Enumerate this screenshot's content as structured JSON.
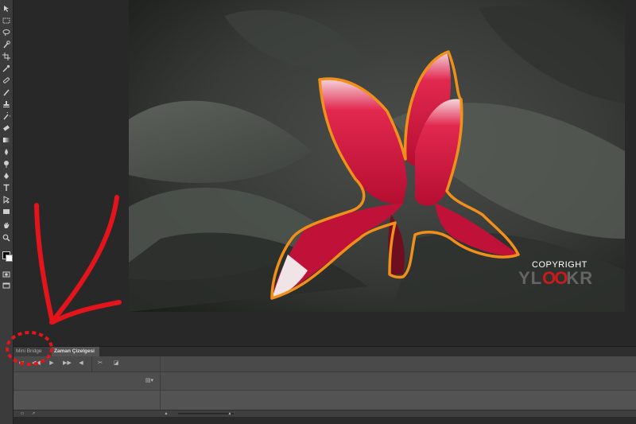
{
  "tools": [
    {
      "name": "move-tool-icon"
    },
    {
      "name": "marquee-tool-icon"
    },
    {
      "name": "lasso-tool-icon"
    },
    {
      "name": "quick-selection-tool-icon"
    },
    {
      "name": "crop-tool-icon"
    },
    {
      "name": "eyedropper-tool-icon"
    },
    {
      "name": "spot-healing-brush-icon"
    },
    {
      "name": "brush-tool-icon"
    },
    {
      "name": "clone-stamp-tool-icon"
    },
    {
      "name": "history-brush-icon"
    },
    {
      "name": "eraser-tool-icon"
    },
    {
      "name": "gradient-tool-icon"
    },
    {
      "name": "blur-tool-icon"
    },
    {
      "name": "dodge-tool-icon"
    },
    {
      "name": "pen-tool-icon"
    },
    {
      "name": "type-tool-icon"
    },
    {
      "name": "path-selection-tool-icon"
    },
    {
      "name": "rectangle-tool-icon"
    },
    {
      "name": "hand-tool-icon"
    },
    {
      "name": "zoom-tool-icon"
    }
  ],
  "watermark": {
    "copyright": "COPYRIGHT",
    "brand_left": "YL",
    "brand_mid": "OO",
    "brand_right": "KR"
  },
  "panel": {
    "tab_inactive": "Mini Bridge",
    "tab_active": "Zaman Çizelgesi"
  },
  "colors": {
    "selection_outline": "#f0901a",
    "annotation_red": "#e3141b",
    "flower": "#d8173f"
  }
}
